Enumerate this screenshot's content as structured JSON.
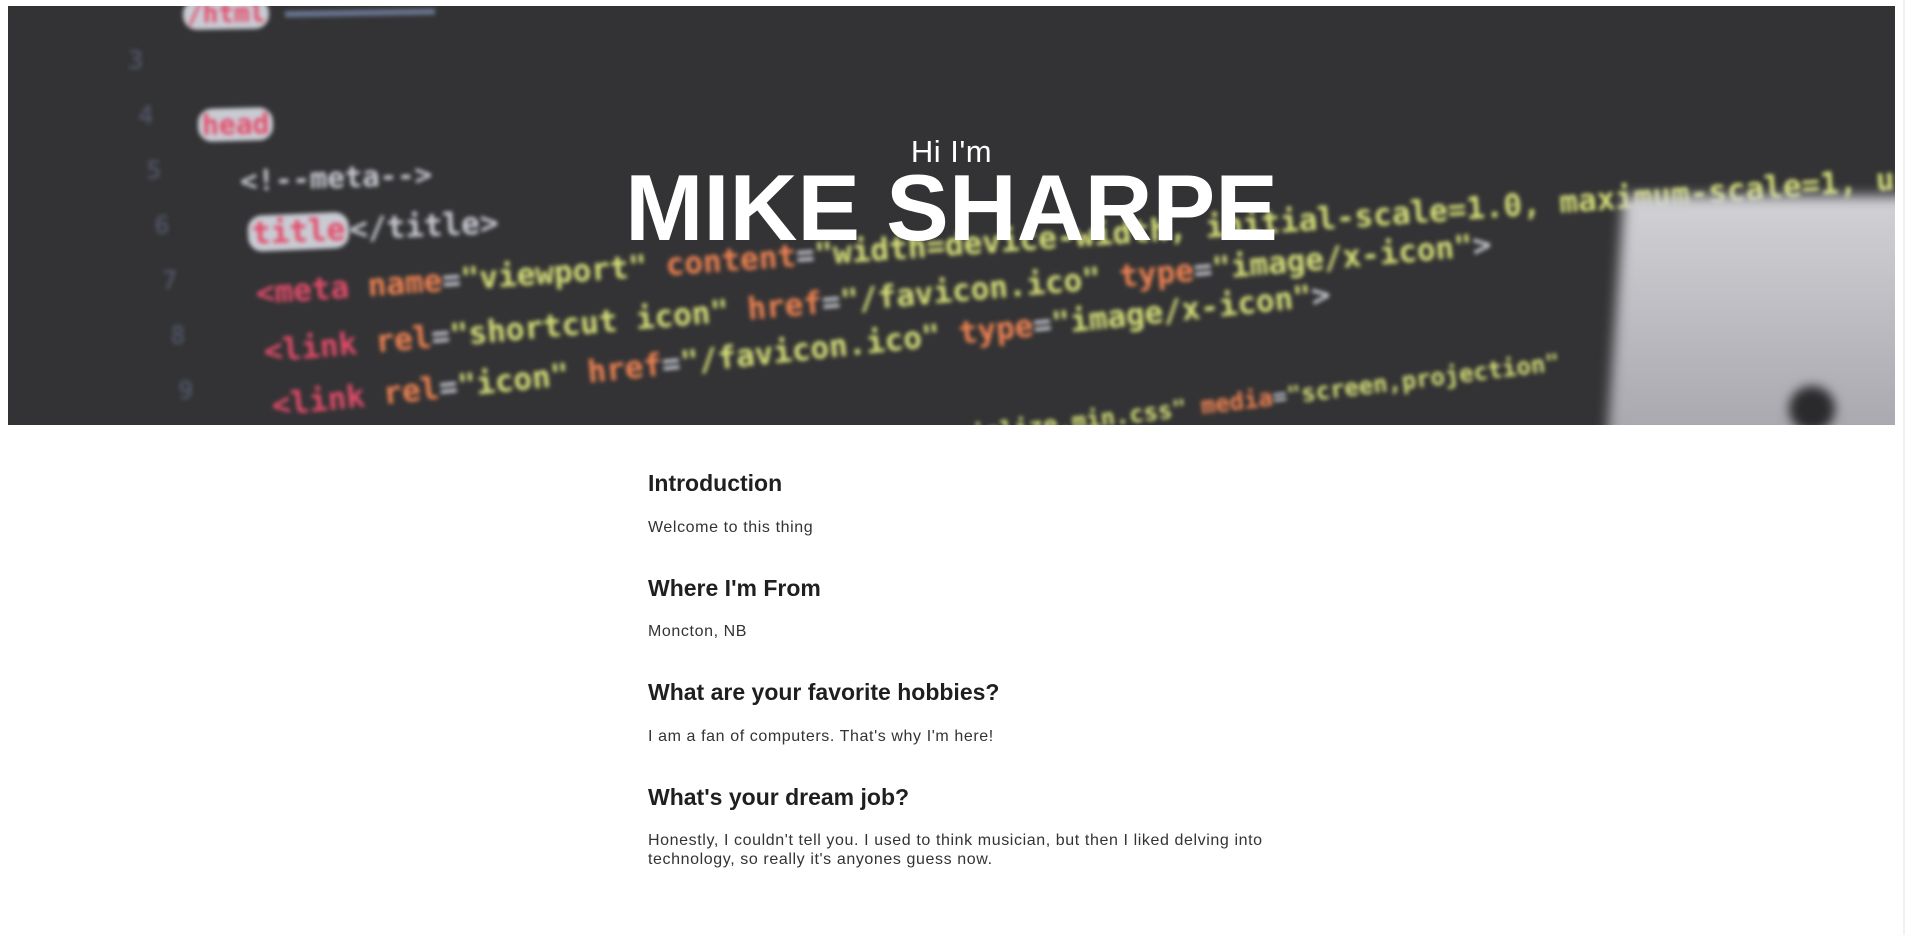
{
  "hero": {
    "greeting": "Hi I'm",
    "name": "MIKE SHARPE"
  },
  "sections": [
    {
      "heading": "Introduction",
      "body": "Welcome to this thing"
    },
    {
      "heading": "Where I'm From",
      "body": "Moncton, NB"
    },
    {
      "heading": "What are your favorite hobbies?",
      "body": "I am a fan of computers. That's why I'm here!"
    },
    {
      "heading": "What's your dream job?",
      "body": "Honestly, I couldn't tell you. I used to think musician, but then I liked delving into technology, so really it's anyones guess now."
    }
  ]
}
